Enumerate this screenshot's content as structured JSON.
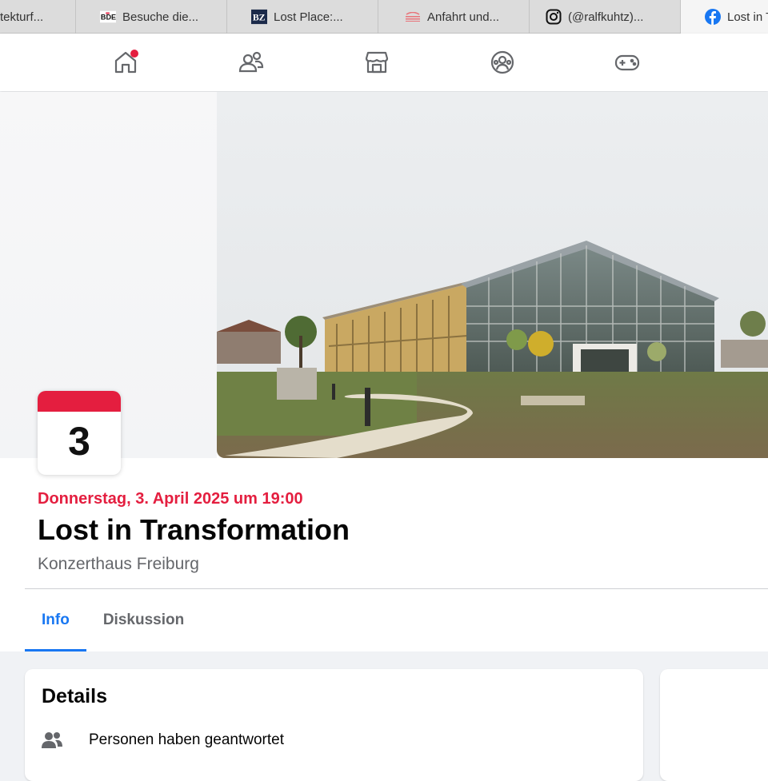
{
  "browser_tabs": [
    {
      "title": "tekturf...",
      "favicon": "generic"
    },
    {
      "title": "Besuche die...",
      "favicon": "bde-logo"
    },
    {
      "title": "Lost Place:...",
      "favicon": "bz-logo"
    },
    {
      "title": "Anfahrt und...",
      "favicon": "stripes-logo"
    },
    {
      "title": "(@ralfkuhtz)...",
      "favicon": "instagram-icon"
    },
    {
      "title": "Lost in T",
      "favicon": "facebook-icon"
    }
  ],
  "favicon_text": {
    "bde": "BDE",
    "bz": "BZ"
  },
  "nav": {
    "items": [
      "home-icon",
      "friends-icon",
      "marketplace-icon",
      "groups-icon",
      "gaming-icon"
    ],
    "home_has_notification": true
  },
  "event": {
    "calendar_day": "3",
    "date_line": "Donnerstag, 3. April 2025 um 19:00",
    "title": "Lost in Transformation",
    "venue": "Konzerthaus Freiburg"
  },
  "event_tabs": [
    {
      "label": "Info",
      "active": true
    },
    {
      "label": "Diskussion",
      "active": false
    }
  ],
  "details": {
    "heading": "Details",
    "responded_text": "Personen haben geantwortet"
  },
  "colors": {
    "accent": "#1877f2",
    "date_red": "#e41e3f",
    "muted": "#65676b"
  }
}
